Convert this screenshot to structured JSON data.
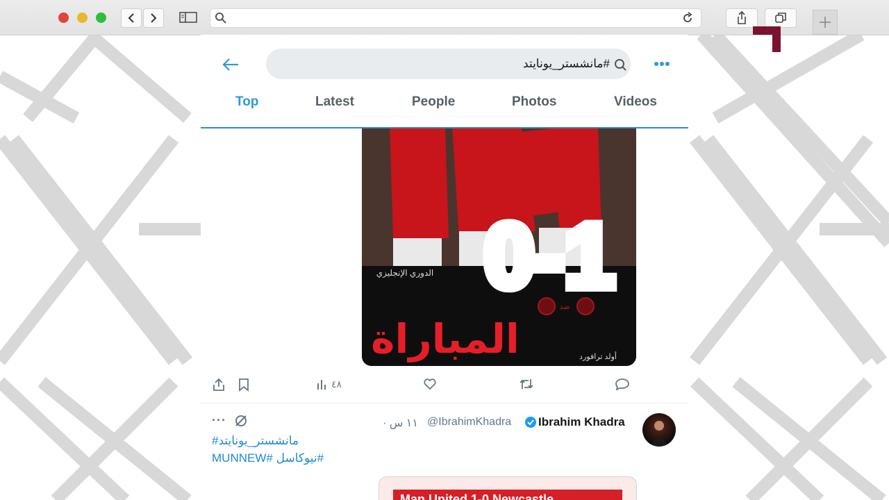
{
  "browser": {
    "traffic_lights": [
      "#e0443e",
      "#e9b82b",
      "#2bbf3c"
    ],
    "address_text": ""
  },
  "search": {
    "query": "#مانشستر_يونايتد"
  },
  "tabs": [
    {
      "label": "Top",
      "active": true
    },
    {
      "label": "Latest",
      "active": false
    },
    {
      "label": "People",
      "active": false
    },
    {
      "label": "Photos",
      "active": false
    },
    {
      "label": "Videos",
      "active": false
    }
  ],
  "tweet1": {
    "media": {
      "score": "0-1",
      "league_label": "الدوري الإنجليزي",
      "vs_label": "ضد",
      "headline": "المباراة",
      "venue": "أولد ترافورد"
    },
    "views_count": "٤٨"
  },
  "tweet2": {
    "display_name": "Ibrahim Khadra",
    "handle": "@IbrahimKhadra",
    "time": "١١ س ·",
    "hashtag_line1": "#مانشستر_يونايتد",
    "hashtag_line2": "#نيوكاسل #MUNNEW",
    "card_headline": "Man United 1-0 Newcastle"
  },
  "colors": {
    "accent": "#2e9ad8",
    "logo": "#7a1230",
    "card_red": "#d71f27"
  }
}
